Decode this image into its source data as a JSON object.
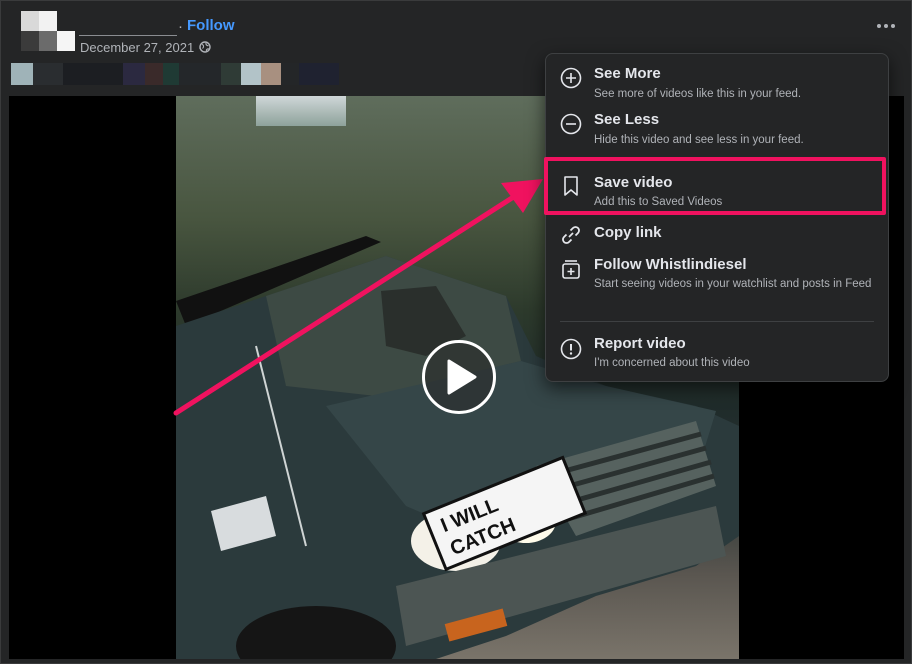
{
  "post": {
    "follow_label": "Follow",
    "separator": "·",
    "date": "December 27, 2021",
    "date_separator": "·"
  },
  "video": {
    "sign_text": "I WILL CATCH"
  },
  "menu": {
    "items": [
      {
        "title": "See More",
        "subtitle": "See more of videos like this in your feed.",
        "icon": "plus-circle-icon"
      },
      {
        "title": "See Less",
        "subtitle": "Hide this video and see less in your feed.",
        "icon": "minus-circle-icon"
      },
      {
        "title": "Save video",
        "subtitle": "Add this to Saved Videos",
        "icon": "bookmark-icon"
      },
      {
        "title": "Copy link",
        "subtitle": "",
        "icon": "link-icon"
      },
      {
        "title": "Follow Whistlindiesel",
        "subtitle": "Start seeing videos in your watchlist and posts in Feed",
        "icon": "add-video-icon"
      },
      {
        "title": "Report video",
        "subtitle": "I'm concerned about this video",
        "icon": "alert-circle-icon"
      }
    ]
  },
  "colors": {
    "accent_link": "#4599ff",
    "highlight": "#f0125f",
    "menu_bg": "#242526"
  }
}
